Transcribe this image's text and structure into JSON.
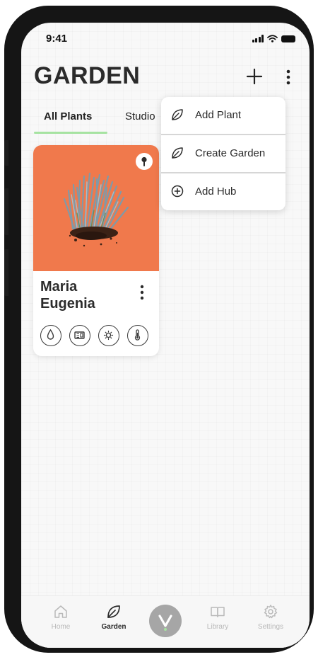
{
  "status_bar": {
    "time": "9:41"
  },
  "header": {
    "title": "GARDEN"
  },
  "tabs": [
    {
      "label": "All Plants",
      "active": true
    },
    {
      "label": "Studio",
      "active": false
    }
  ],
  "dropdown_menu": {
    "items": [
      {
        "label": "Add Plant",
        "icon": "leaf-icon"
      },
      {
        "label": "Create Garden",
        "icon": "leaf-icon"
      },
      {
        "label": "Add Hub",
        "icon": "plus-circle-icon"
      }
    ]
  },
  "plant_card": {
    "name": "Maria Eugenia",
    "photo_background": "#f0794c",
    "sensors": [
      "water-drop-icon",
      "soil-meter-icon",
      "sun-icon",
      "thermometer-icon"
    ]
  },
  "bottom_nav": {
    "items": [
      {
        "label": "Home",
        "icon": "home-icon",
        "active": false
      },
      {
        "label": "Garden",
        "icon": "leaf-icon",
        "active": true
      },
      {
        "label": "Library",
        "icon": "book-icon",
        "active": false
      },
      {
        "label": "Settings",
        "icon": "gear-icon",
        "active": false
      }
    ],
    "center_icon": "logo-v-icon"
  },
  "colors": {
    "accent_green": "#a6e3a1",
    "card_orange": "#f0794c",
    "text_dark": "#2b2b2b",
    "nav_inactive": "#b9b9b9"
  }
}
